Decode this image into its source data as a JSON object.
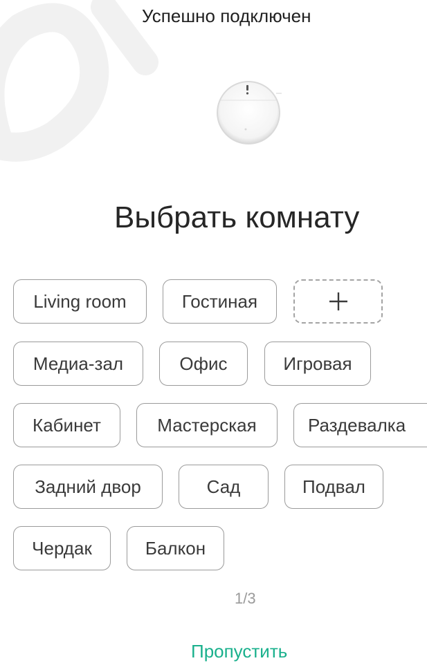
{
  "status": {
    "text": "Успешно подключен"
  },
  "page": {
    "title": "Выбрать комнату"
  },
  "rooms": [
    {
      "label": "Living room"
    },
    {
      "label": "Гостиная"
    },
    {
      "label": "Медиа-зал"
    },
    {
      "label": "Офис"
    },
    {
      "label": "Игровая"
    },
    {
      "label": "Кабинет"
    },
    {
      "label": "Мастерская"
    },
    {
      "label": "Раздевалка"
    },
    {
      "label": "Задний двор"
    },
    {
      "label": "Сад"
    },
    {
      "label": "Подвал"
    },
    {
      "label": "Чердак"
    },
    {
      "label": "Балкон"
    }
  ],
  "add_button": {
    "icon": "plus-icon"
  },
  "pager": {
    "text": "1/3"
  },
  "footer": {
    "skip_label": "Пропустить",
    "accent_color": "#19b08c"
  }
}
